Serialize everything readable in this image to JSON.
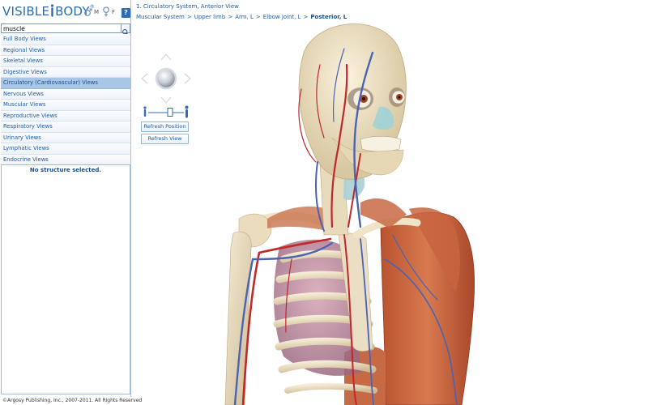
{
  "app": {
    "logo_text_1": "VISIBLE",
    "logo_text_2": "BODY",
    "logo_reg": "®",
    "gender_m": "M",
    "gender_f": "F",
    "help_label": "?"
  },
  "search": {
    "value": "muscle"
  },
  "view_list": [
    "Full Body Views",
    "Regional Views",
    "Skeletal Views",
    "Digestive Views",
    "Circulatory (Cardiovascular) Views",
    "Nervous Views",
    "Muscular Views",
    "Reproductive Views",
    "Respiratory Views",
    "Urinary Views",
    "Lymphatic Views",
    "Endocrine Views"
  ],
  "selected_view": "Circulatory (Cardiovascular) Views",
  "structure_panel": {
    "message": "No structure selected."
  },
  "main": {
    "view_title": "1. Circulatory System, Anterior View",
    "breadcrumb": [
      "Muscular System",
      "Upper limb",
      "Arm, L",
      "Elbow joint, L",
      "Posterior, L"
    ],
    "breadcrumb_separator": ">",
    "refresh_position_label": "Refresh Position",
    "refresh_view_label": "Refresh View"
  },
  "footer": {
    "copyright": "©Argosy Publishing, Inc., 2007-2011. All Rights Reserved"
  },
  "colors": {
    "accent": "#1f5ea8",
    "selected_row": "#a9c6e6",
    "bone": "#e9dcc0",
    "artery": "#c0282a",
    "vein": "#4b63b3",
    "muscle": "#c5613a"
  }
}
